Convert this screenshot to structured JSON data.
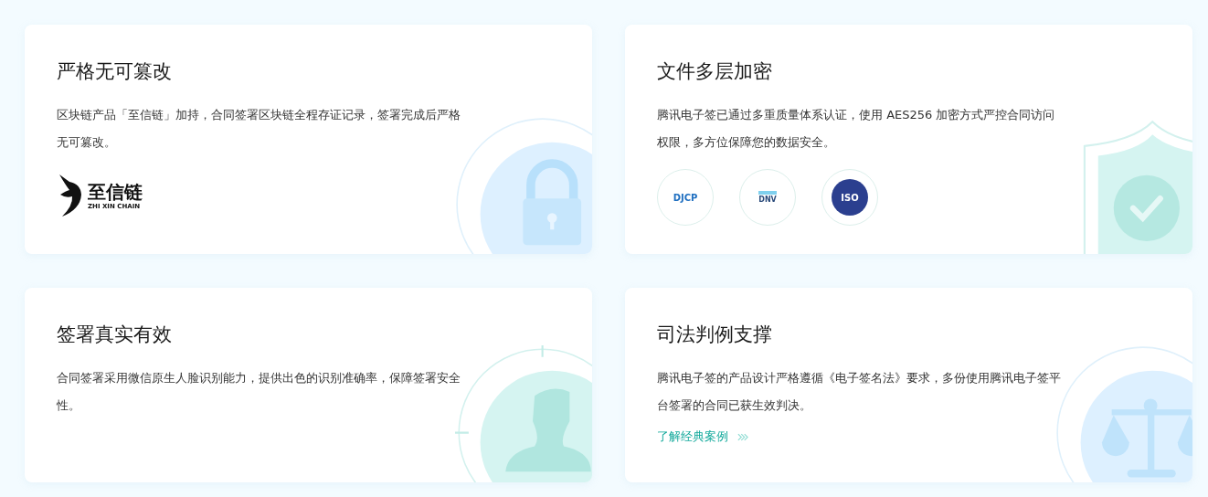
{
  "cards": [
    {
      "kind": "logo",
      "title": "严格无可篡改",
      "text": "区块链产品「至信链」加持，合同签署区块链全程存证记录，签署完成后严格无可篡改。",
      "logo": {
        "name": "至信链",
        "subtitle": "ZHI XIN CHAIN"
      }
    },
    {
      "kind": "badges",
      "title": "文件多层加密",
      "text": "腾讯电子签已通过多重质量体系认证，使用 AES256 加密方式严控合同访问权限，多方位保障您的数据安全。",
      "badges": [
        "DJCP",
        "DNV",
        "ISO"
      ]
    },
    {
      "kind": "plain",
      "title": "签署真实有效",
      "text": "合同签署采用微信原生人脸识别能力，提供出色的识别准确率，保障签署安全性。"
    },
    {
      "kind": "link",
      "title": "司法判例支撑",
      "text": "腾讯电子签的产品设计严格遵循《电子签名法》要求，多份使用腾讯电子签平台签署的合同已获生效判决。",
      "link": "了解经典案例"
    }
  ]
}
